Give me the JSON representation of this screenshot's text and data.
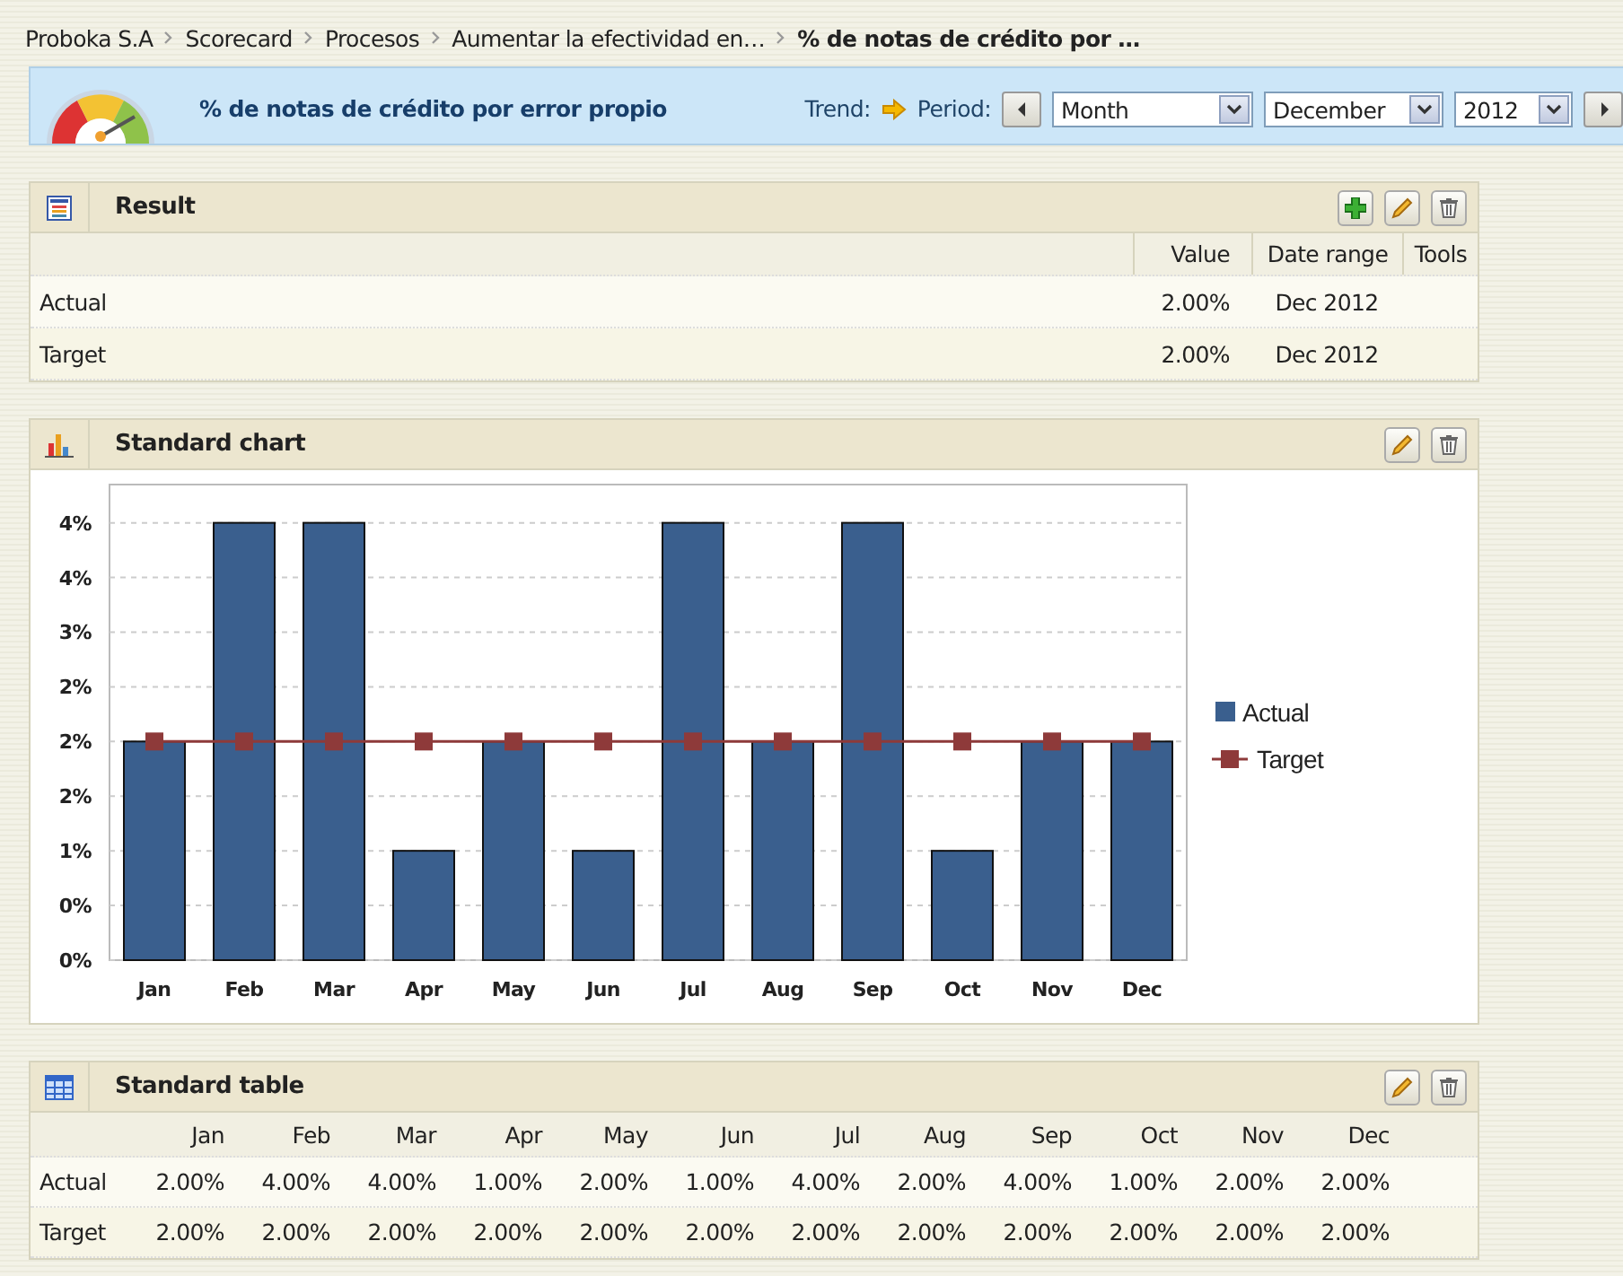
{
  "breadcrumb": [
    {
      "label": "Proboka S.A",
      "current": false
    },
    {
      "label": "Scorecard",
      "current": false
    },
    {
      "label": "Procesos",
      "current": false
    },
    {
      "label": "Aumentar la efectividad en…",
      "current": false
    },
    {
      "label": "% de notas de crédito por …",
      "current": true
    }
  ],
  "header": {
    "title": "% de notas de crédito por error propio",
    "trend_label": "Trend:",
    "period_label": "Period:",
    "selects": [
      {
        "value": "Month"
      },
      {
        "value": "December"
      },
      {
        "value": "2012"
      }
    ]
  },
  "result": {
    "title": "Result",
    "tools": [
      {
        "kind": "add"
      },
      {
        "kind": "edit"
      },
      {
        "kind": "delete"
      }
    ],
    "columns": [
      "Value",
      "Date range",
      "Tools"
    ],
    "rows": [
      {
        "label": "Actual",
        "value": "2.00%",
        "date_range": "Dec 2012"
      },
      {
        "label": "Target",
        "value": "2.00%",
        "date_range": "Dec 2012"
      }
    ]
  },
  "chart": {
    "title": "Standard chart",
    "tools": [
      {
        "kind": "edit"
      },
      {
        "kind": "delete"
      }
    ],
    "chart_data": {
      "type": "bar",
      "categories": [
        "Jan",
        "Feb",
        "Mar",
        "Apr",
        "May",
        "Jun",
        "Jul",
        "Aug",
        "Sep",
        "Oct",
        "Nov",
        "Dec"
      ],
      "ylim": [
        0,
        4.35
      ],
      "grid": "y",
      "legend": "right",
      "yticks": [
        {
          "value": 0,
          "label": "0%"
        },
        {
          "value": 0.5,
          "label": "0%"
        },
        {
          "value": 1,
          "label": "1%"
        },
        {
          "value": 1.5,
          "label": "2%"
        },
        {
          "value": 2,
          "label": "2%"
        },
        {
          "value": 2.5,
          "label": "2%"
        },
        {
          "value": 3,
          "label": "3%"
        },
        {
          "value": 3.5,
          "label": "4%"
        },
        {
          "value": 4,
          "label": "4%"
        }
      ],
      "series": [
        {
          "name": "Actual",
          "type": "bar",
          "color": "#3a5f8e",
          "values": [
            2,
            4,
            4,
            1,
            2,
            1,
            4,
            2,
            4,
            1,
            2,
            2
          ]
        },
        {
          "name": "Target",
          "type": "line",
          "marker": "square",
          "color": "#8e3a3a",
          "values": [
            2,
            2,
            2,
            2,
            2,
            2,
            2,
            2,
            2,
            2,
            2,
            2
          ]
        }
      ]
    }
  },
  "table": {
    "title": "Standard table",
    "tools": [
      {
        "kind": "edit"
      },
      {
        "kind": "delete"
      }
    ],
    "columns": [
      "Jan",
      "Feb",
      "Mar",
      "Apr",
      "May",
      "Jun",
      "Jul",
      "Aug",
      "Sep",
      "Oct",
      "Nov",
      "Dec"
    ],
    "rows": [
      {
        "label": "Actual",
        "values": [
          "2.00%",
          "4.00%",
          "4.00%",
          "1.00%",
          "2.00%",
          "1.00%",
          "4.00%",
          "2.00%",
          "4.00%",
          "1.00%",
          "2.00%",
          "2.00%"
        ]
      },
      {
        "label": "Target",
        "values": [
          "2.00%",
          "2.00%",
          "2.00%",
          "2.00%",
          "2.00%",
          "2.00%",
          "2.00%",
          "2.00%",
          "2.00%",
          "2.00%",
          "2.00%",
          "2.00%"
        ]
      }
    ]
  }
}
